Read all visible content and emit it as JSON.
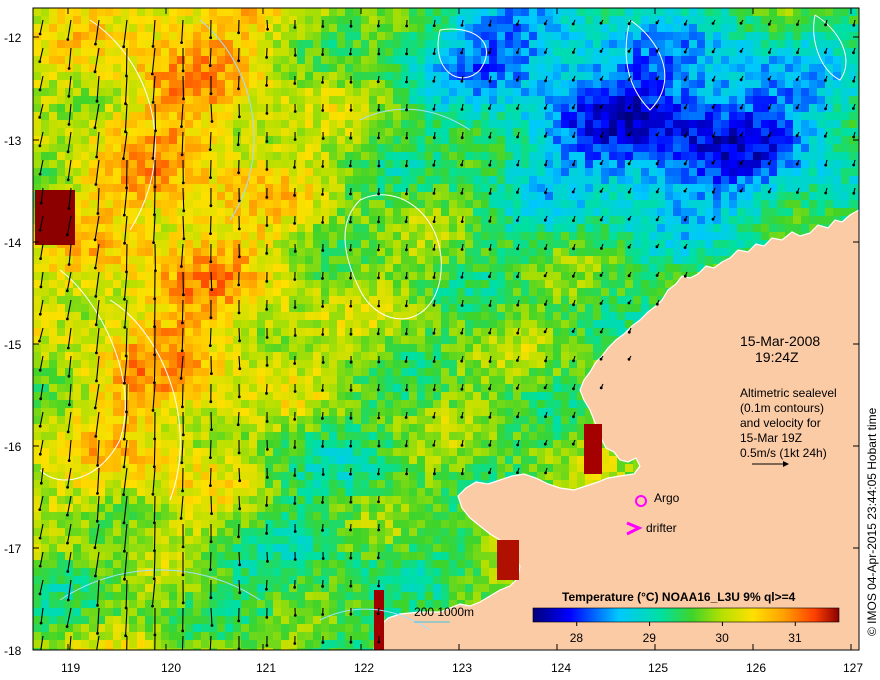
{
  "map": {
    "lon_ticks": [
      "119",
      "120",
      "121",
      "122",
      "123",
      "124",
      "125",
      "126",
      "127"
    ],
    "lat_ticks": [
      "-12",
      "-13",
      "-14",
      "-15",
      "-16",
      "-17",
      "-18"
    ],
    "lon_range": [
      118.6,
      127
    ],
    "lat_range": [
      -18,
      -11.8
    ]
  },
  "date": {
    "line1": "15-Mar-2008",
    "line2": "19:24Z"
  },
  "annotation": {
    "line1": "Altimetric sealevel",
    "line2": "(0.1m contours)",
    "line3": "and velocity for",
    "line4": "15-Mar 19Z",
    "line5": "0.5m/s (1kt 24h)"
  },
  "legend": {
    "argo_label": "Argo",
    "drifter_label": "drifter",
    "argo_color": "#ff00ff",
    "drifter_color": "#ff00ff"
  },
  "bathy": {
    "label": "200  1000m"
  },
  "colorbar": {
    "title": "Temperature (°C) NOAA16_L3U 9% ql>=4",
    "ticks": [
      "28",
      "29",
      "30",
      "31"
    ],
    "tick_values": [
      28,
      29,
      30,
      31
    ],
    "range": [
      27.4,
      31.6
    ]
  },
  "credit": {
    "text": "© IMOS 04-Apr-2015 23:44:05 Hobart time"
  },
  "colors": {
    "land": "#fbcba6",
    "coast": "#ffffff"
  }
}
